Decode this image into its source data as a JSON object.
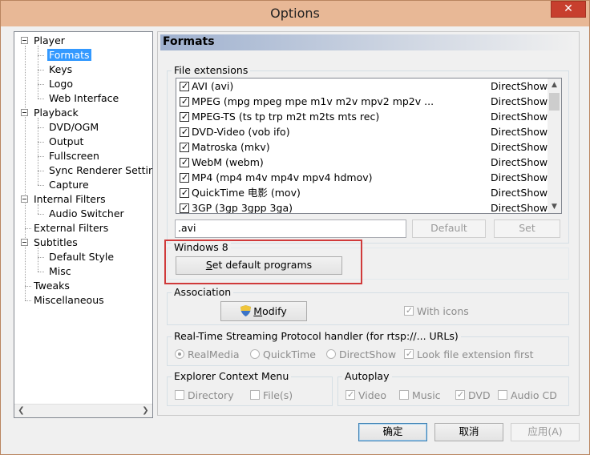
{
  "window": {
    "title": "Options",
    "close_glyph": "✕"
  },
  "tree": [
    {
      "label": "Player",
      "level": 0,
      "toggle": true
    },
    {
      "label": "Formats",
      "level": 1,
      "selected": true
    },
    {
      "label": "Keys",
      "level": 1
    },
    {
      "label": "Logo",
      "level": 1
    },
    {
      "label": "Web Interface",
      "level": 1
    },
    {
      "label": "Playback",
      "level": 0,
      "toggle": true
    },
    {
      "label": "DVD/OGM",
      "level": 1
    },
    {
      "label": "Output",
      "level": 1
    },
    {
      "label": "Fullscreen",
      "level": 1
    },
    {
      "label": "Sync Renderer Setting",
      "level": 1
    },
    {
      "label": "Capture",
      "level": 1
    },
    {
      "label": "Internal Filters",
      "level": 0,
      "toggle": true
    },
    {
      "label": "Audio Switcher",
      "level": 1
    },
    {
      "label": "External Filters",
      "level": 0
    },
    {
      "label": "Subtitles",
      "level": 0,
      "toggle": true
    },
    {
      "label": "Default Style",
      "level": 1
    },
    {
      "label": "Misc",
      "level": 1
    },
    {
      "label": "Tweaks",
      "level": 0
    },
    {
      "label": "Miscellaneous",
      "level": 0
    }
  ],
  "panel": {
    "title": "Formats",
    "file_extensions_label": "File extensions",
    "extensions": [
      {
        "name": "AVI (avi)",
        "handler": "DirectShow",
        "checked": true
      },
      {
        "name": "MPEG (mpg mpeg mpe m1v m2v mpv2 mp2v ...",
        "handler": "DirectShow",
        "checked": true
      },
      {
        "name": "MPEG-TS (ts tp trp m2t m2ts mts rec)",
        "handler": "DirectShow",
        "checked": true
      },
      {
        "name": "DVD-Video (vob ifo)",
        "handler": "DirectShow",
        "checked": true
      },
      {
        "name": "Matroska (mkv)",
        "handler": "DirectShow",
        "checked": true
      },
      {
        "name": "WebM (webm)",
        "handler": "DirectShow",
        "checked": true
      },
      {
        "name": "MP4 (mp4 m4v mp4v mpv4 hdmov)",
        "handler": "DirectShow",
        "checked": true
      },
      {
        "name": "QuickTime 电影 (mov)",
        "handler": "DirectShow",
        "checked": true
      },
      {
        "name": "3GP (3gp 3gpp 3ga)",
        "handler": "DirectShow",
        "checked": true
      }
    ],
    "ext_value": ".avi",
    "default_label": "Default",
    "set_label": "Set",
    "windows8_label": "Windows 8",
    "set_default_programs_label": "Set default programs",
    "association_label": "Association",
    "modify_label": "Modify",
    "with_icons_label": "With icons",
    "with_icons_checked": true,
    "rtsp_label": "Real-Time Streaming Protocol handler (for rtsp://... URLs)",
    "rtsp_options": [
      {
        "label": "RealMedia",
        "checked": true
      },
      {
        "label": "QuickTime",
        "checked": false
      },
      {
        "label": "DirectShow",
        "checked": false
      }
    ],
    "look_ext_first_label": "Look file extension first",
    "look_ext_first_checked": true,
    "explorer_menu_label": "Explorer Context Menu",
    "directory_label": "Directory",
    "files_label": "File(s)",
    "autoplay_label": "Autoplay",
    "autoplay_options": [
      {
        "label": "Video",
        "checked": true
      },
      {
        "label": "Music",
        "checked": false
      },
      {
        "label": "DVD",
        "checked": true
      },
      {
        "label": "Audio CD",
        "checked": false
      }
    ]
  },
  "footer": {
    "ok_label": "确定",
    "cancel_label": "取消",
    "apply_label": "应用(A)"
  }
}
